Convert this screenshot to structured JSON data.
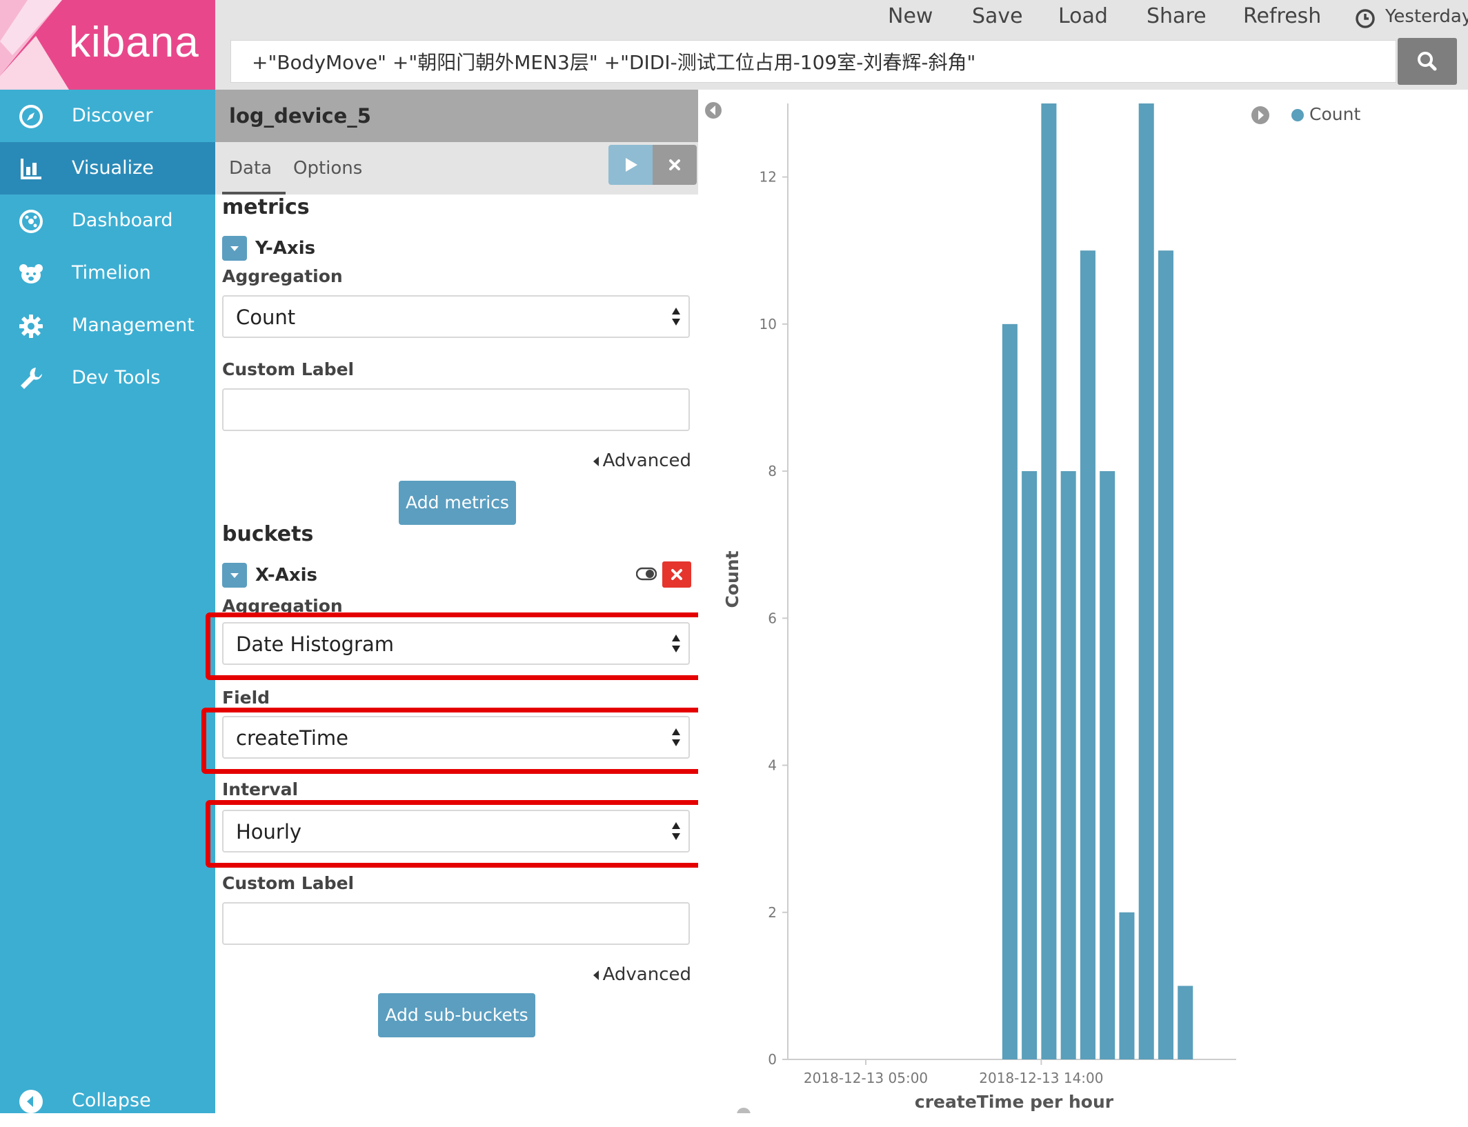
{
  "app": {
    "logo_text": "kibana",
    "colors": {
      "sidebar": "#3caed2",
      "logo_bg": "#e8488b",
      "accent": "#5b9ec0",
      "highlight": "#e50000"
    }
  },
  "sidebar": {
    "items": [
      {
        "label": "Discover",
        "icon": "compass-icon"
      },
      {
        "label": "Visualize",
        "icon": "bar-chart-icon",
        "active": true
      },
      {
        "label": "Dashboard",
        "icon": "dashboard-icon"
      },
      {
        "label": "Timelion",
        "icon": "bear-icon"
      },
      {
        "label": "Management",
        "icon": "gear-icon"
      },
      {
        "label": "Dev Tools",
        "icon": "wrench-icon"
      }
    ],
    "collapse_label": "Collapse"
  },
  "topbar": {
    "links": [
      "New",
      "Save",
      "Load",
      "Share",
      "Refresh"
    ],
    "time_label": "Yesterday",
    "query": "+\"BodyMove\" +\"朝阳门朝外MEN3层\" +\"DIDI-测试工位占用-109室-刘春辉-斜角\""
  },
  "editor": {
    "index_name": "log_device_5",
    "tabs": [
      "Data",
      "Options"
    ],
    "metrics": {
      "section_title": "metrics",
      "agg_title": "Y-Axis",
      "aggregation_label": "Aggregation",
      "aggregation_value": "Count",
      "custom_label_label": "Custom Label",
      "custom_label_value": "",
      "advanced_label": "Advanced",
      "add_button": "Add metrics"
    },
    "buckets": {
      "section_title": "buckets",
      "agg_title": "X-Axis",
      "aggregation_label": "Aggregation",
      "aggregation_value": "Date Histogram",
      "field_label": "Field",
      "field_value": "createTime",
      "interval_label": "Interval",
      "interval_value": "Hourly",
      "custom_label_label": "Custom Label",
      "custom_label_value": "",
      "advanced_label": "Advanced",
      "add_button": "Add sub-buckets"
    }
  },
  "chart_data": {
    "type": "bar",
    "x_scale": "time",
    "x_unit": "hour",
    "x_range": [
      "2018-12-13 01:00",
      "2018-12-14 00:00"
    ],
    "x": [
      "2018-12-13 12:00",
      "2018-12-13 13:00",
      "2018-12-13 14:00",
      "2018-12-13 15:00",
      "2018-12-13 16:00",
      "2018-12-13 17:00",
      "2018-12-13 18:00",
      "2018-12-13 19:00",
      "2018-12-13 20:00",
      "2018-12-13 21:00"
    ],
    "values": [
      10,
      8,
      13,
      8,
      11,
      8,
      2,
      13,
      11,
      1
    ],
    "xticks": [
      "2018-12-13 05:00",
      "2018-12-13 14:00"
    ],
    "yticks": [
      0,
      2,
      4,
      6,
      8,
      10,
      12
    ],
    "ylim": [
      0,
      13
    ],
    "xlabel": "createTime per hour",
    "ylabel": "Count",
    "legend": {
      "position": "top-right",
      "entries": [
        "Count"
      ]
    },
    "grid": false,
    "color": "#5a9fbb"
  }
}
